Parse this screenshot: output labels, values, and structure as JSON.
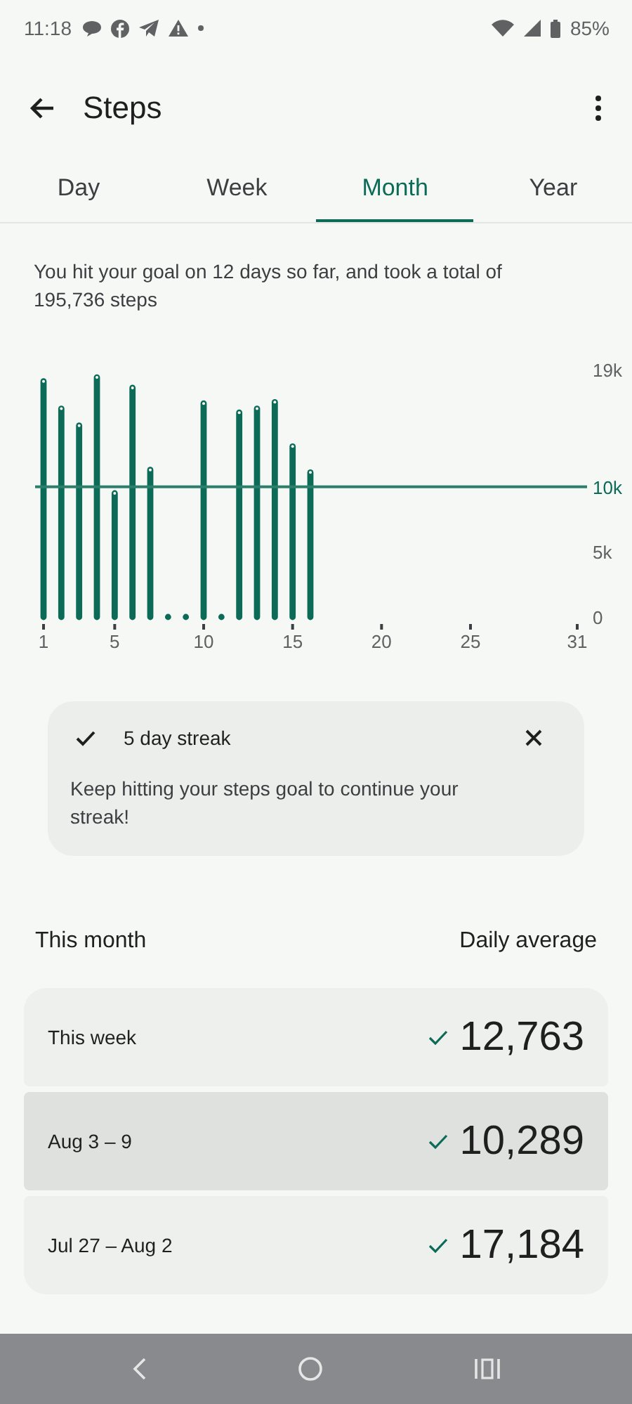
{
  "status_bar": {
    "time": "11:18",
    "battery": "85%"
  },
  "header": {
    "title": "Steps"
  },
  "tabs": [
    {
      "label": "Day",
      "selected": false
    },
    {
      "label": "Week",
      "selected": false
    },
    {
      "label": "Month",
      "selected": true
    },
    {
      "label": "Year",
      "selected": false
    }
  ],
  "summary": "You hit your goal on 12 days so far, and took a total of 195,736 steps",
  "chart": {
    "chart_data": {
      "type": "bar",
      "x": [
        1,
        2,
        3,
        4,
        5,
        6,
        7,
        8,
        9,
        10,
        11,
        12,
        13,
        14,
        15,
        16
      ],
      "values": [
        18100,
        16000,
        14700,
        18400,
        9500,
        17600,
        11300,
        0,
        0,
        16400,
        0,
        15700,
        16000,
        16500,
        13100,
        11100
      ],
      "xlim": [
        1,
        31
      ],
      "ylim": [
        0,
        19000
      ],
      "xticks": [
        1,
        5,
        10,
        15,
        20,
        25,
        31
      ],
      "yticks": [
        0,
        {
          "value": 5000,
          "label": "5k"
        },
        {
          "value": 10000,
          "label": "10k"
        },
        {
          "value": 19000,
          "label": "19k"
        }
      ],
      "ref_lines": [
        {
          "value": 10000,
          "axis": "y"
        }
      ]
    }
  },
  "streak_card": {
    "title": "5 day streak",
    "message": "Keep hitting your steps goal to continue your streak!"
  },
  "section": {
    "title": "This month",
    "right_label": "Daily average"
  },
  "weeks": [
    {
      "label": "This week",
      "value": "12,763",
      "goal_met": true,
      "selected": false
    },
    {
      "label": "Aug 3 – 9",
      "value": "10,289",
      "goal_met": true,
      "selected": true
    },
    {
      "label": "Jul 27 – Aug 2",
      "value": "17,184",
      "goal_met": true,
      "selected": false
    }
  ]
}
